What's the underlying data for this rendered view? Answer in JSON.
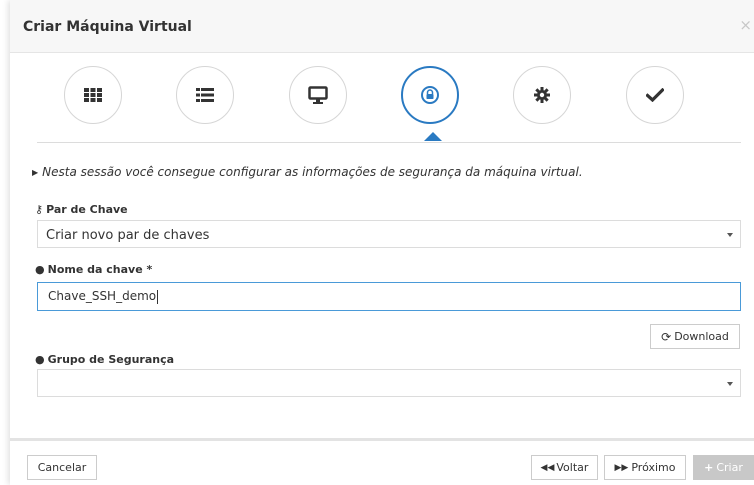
{
  "modal": {
    "title": "Criar Máquina Virtual",
    "close": "×"
  },
  "wizard": {
    "steps": [
      {
        "name": "grid-icon",
        "active": false
      },
      {
        "name": "list-icon",
        "active": false
      },
      {
        "name": "monitor-icon",
        "active": false
      },
      {
        "name": "lock-icon",
        "active": true
      },
      {
        "name": "gear-icon",
        "active": false
      },
      {
        "name": "check-icon",
        "active": false
      }
    ]
  },
  "info_text": "Nesta sessão você consegue configurar as informações de segurança da máquina virtual.",
  "key_pair": {
    "label": "Par de Chave",
    "value": "Criar novo par de chaves"
  },
  "key_name": {
    "label": "Nome da chave *",
    "value": "Chave_SSH_demo"
  },
  "download_label": "Download",
  "security_group": {
    "label": "Grupo de Segurança",
    "value": ""
  },
  "footer": {
    "cancel": "Cancelar",
    "back": "Voltar",
    "next": "Próximo",
    "create": "Criar"
  },
  "colors": {
    "accent": "#2a7ac2",
    "create_disabled": "#c8c8c8"
  }
}
